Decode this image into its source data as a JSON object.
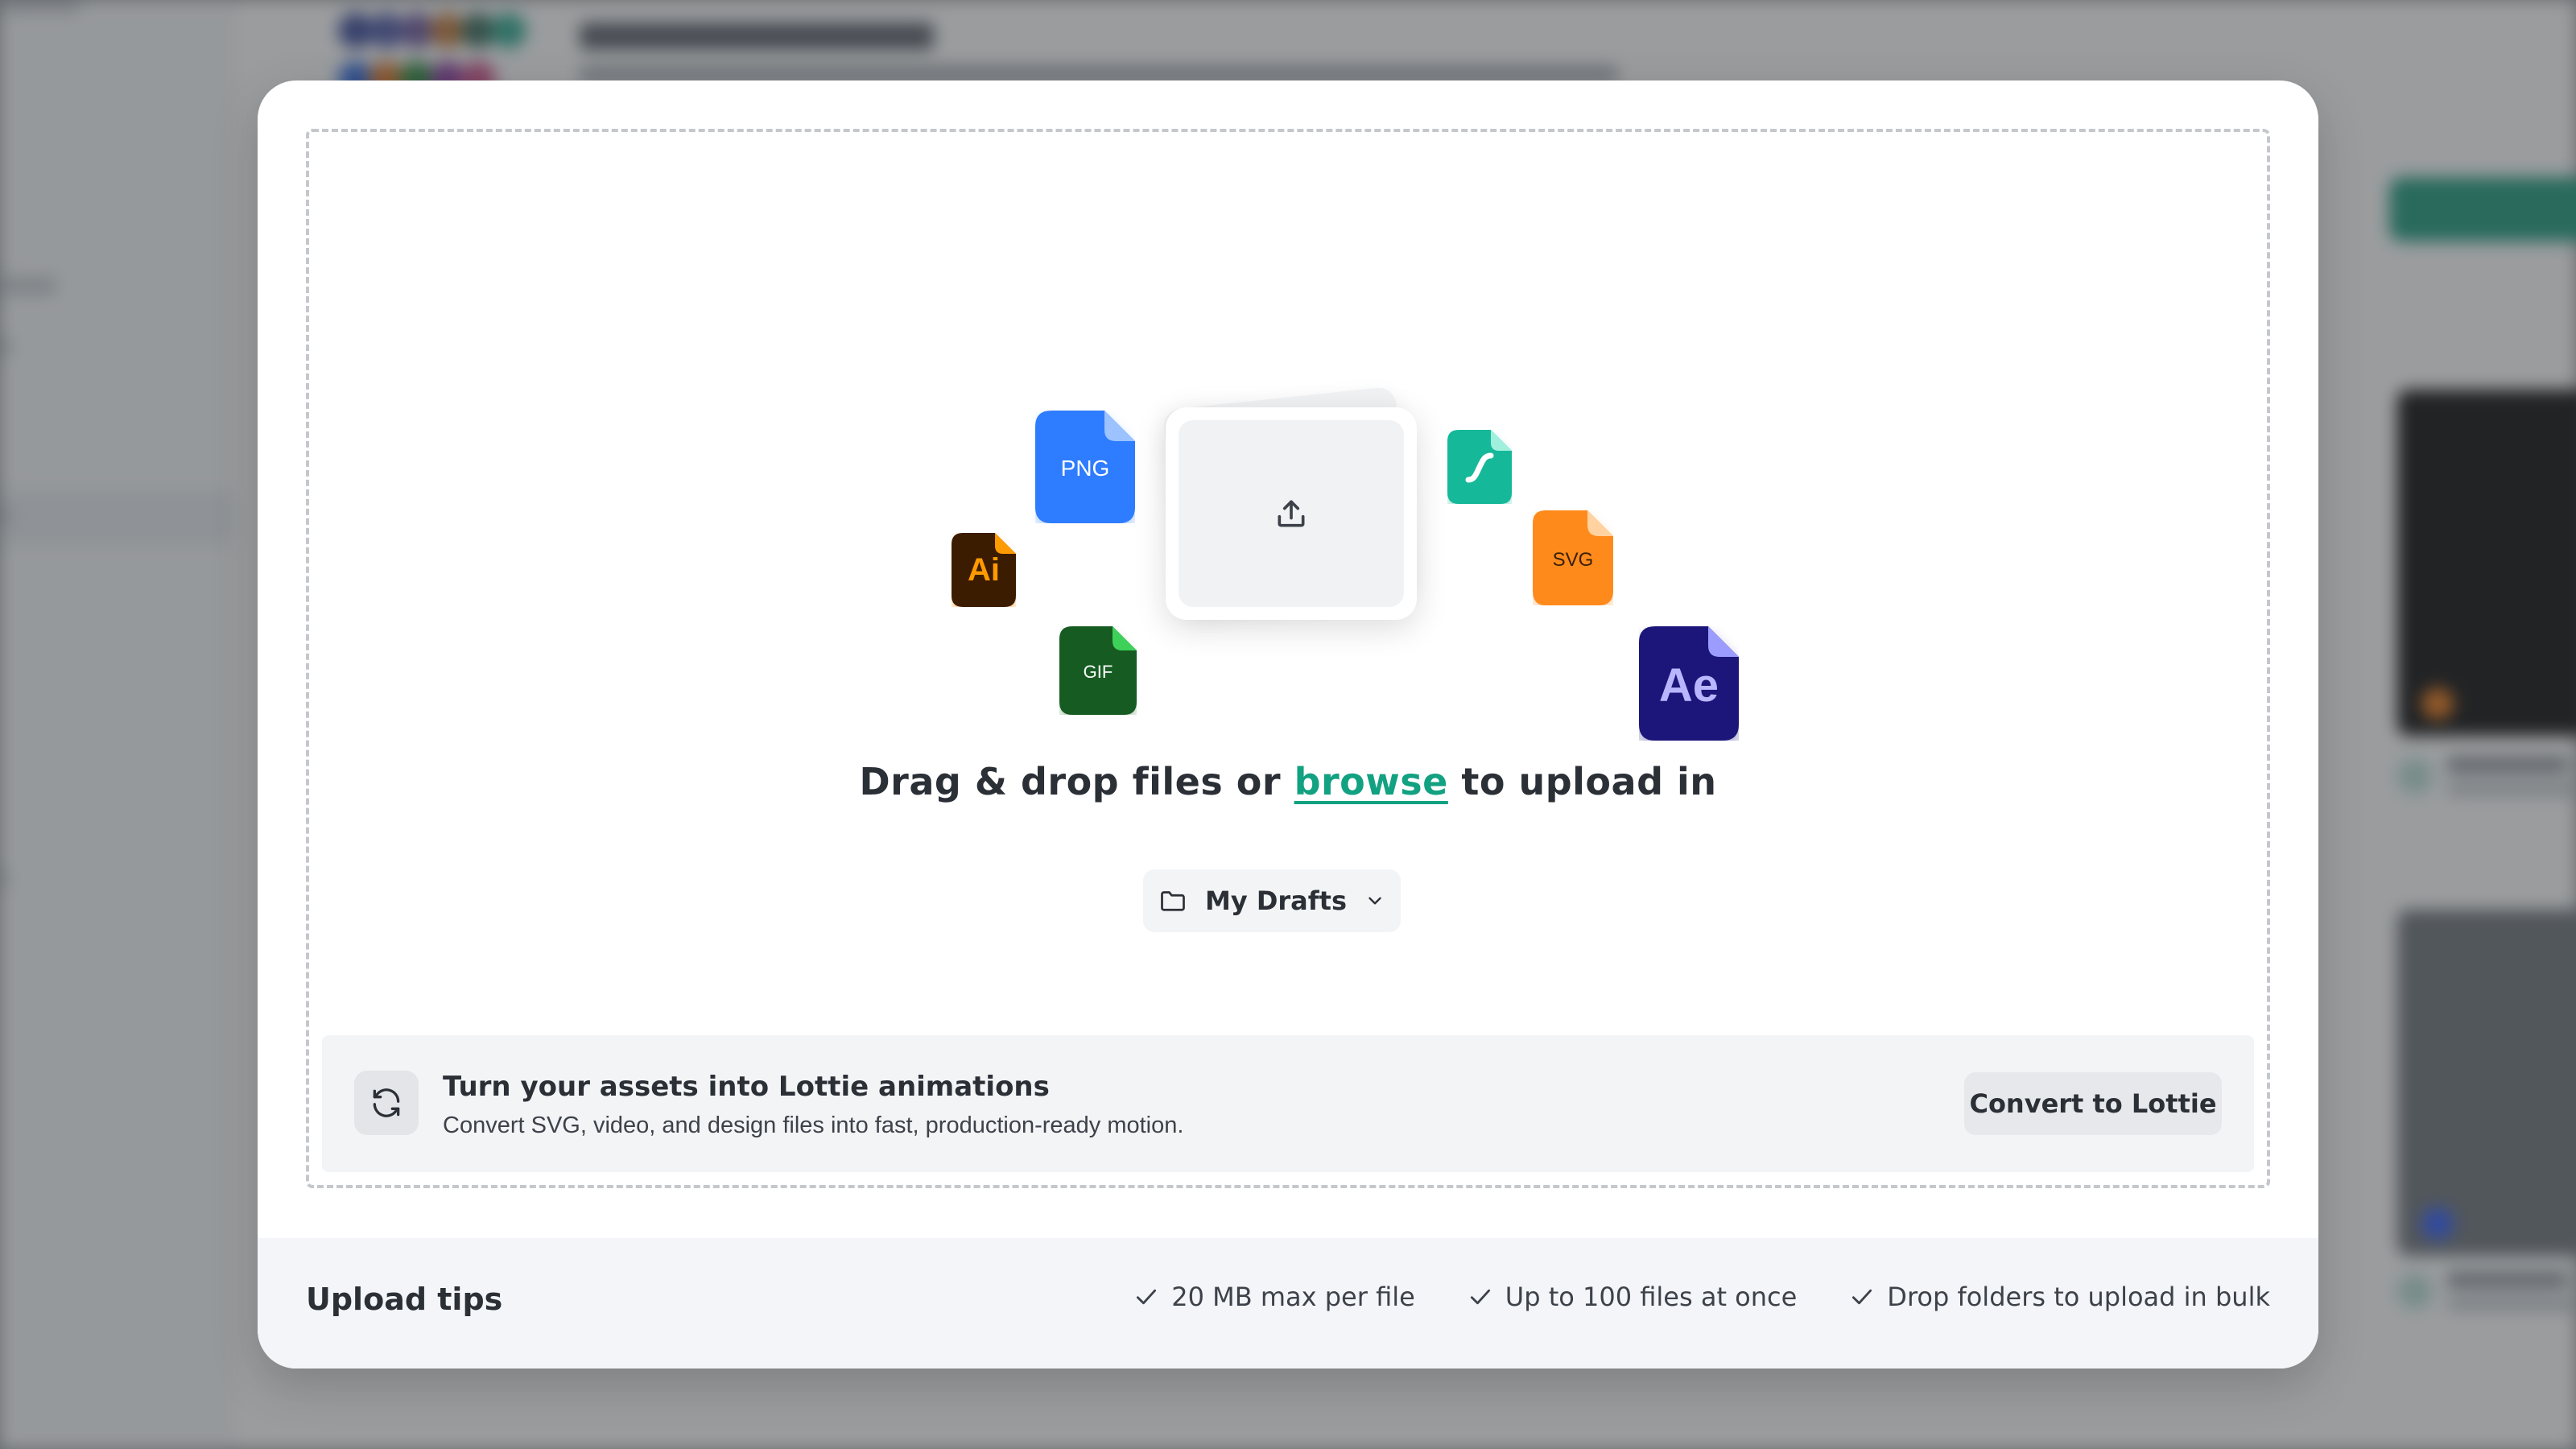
{
  "background": {
    "accent": "#1e9b7d"
  },
  "modal": {
    "file_icons": [
      {
        "name": "png-file-icon",
        "label": "PNG",
        "color": "#2f7cff"
      },
      {
        "name": "illustrator-file-icon",
        "label": "Ai",
        "color": "#3a1f06",
        "accent": "#ff9a00"
      },
      {
        "name": "gif-file-icon",
        "label": "GIF",
        "color": "#165c22"
      },
      {
        "name": "lottie-file-icon",
        "label": "",
        "color": "#14b89a"
      },
      {
        "name": "svg-file-icon",
        "label": "SVG",
        "color": "#ff8a1f"
      },
      {
        "name": "after-effects-file-icon",
        "label": "Ae",
        "color": "#1a157a",
        "accent": "#9c9cff"
      }
    ],
    "drop": {
      "prefix": "Drag & drop files or",
      "link": "browse",
      "suffix": "to upload in"
    },
    "folder": {
      "icon": "folder-icon",
      "label": "My Drafts",
      "caret": "chevron-down-icon"
    },
    "convert": {
      "icon": "refresh-icon",
      "title": "Turn your assets into Lottie animations",
      "description": "Convert SVG, video, and design files into fast, production-ready motion.",
      "button_label": "Convert to Lottie"
    },
    "footer": {
      "title": "Upload tips",
      "tips": [
        "20 MB max per file",
        "Up to 100 files at once",
        "Drop folders to upload in bulk"
      ]
    }
  },
  "colors": {
    "link": "#12a181",
    "text": "#2b2f36",
    "muted": "#3d424a"
  }
}
